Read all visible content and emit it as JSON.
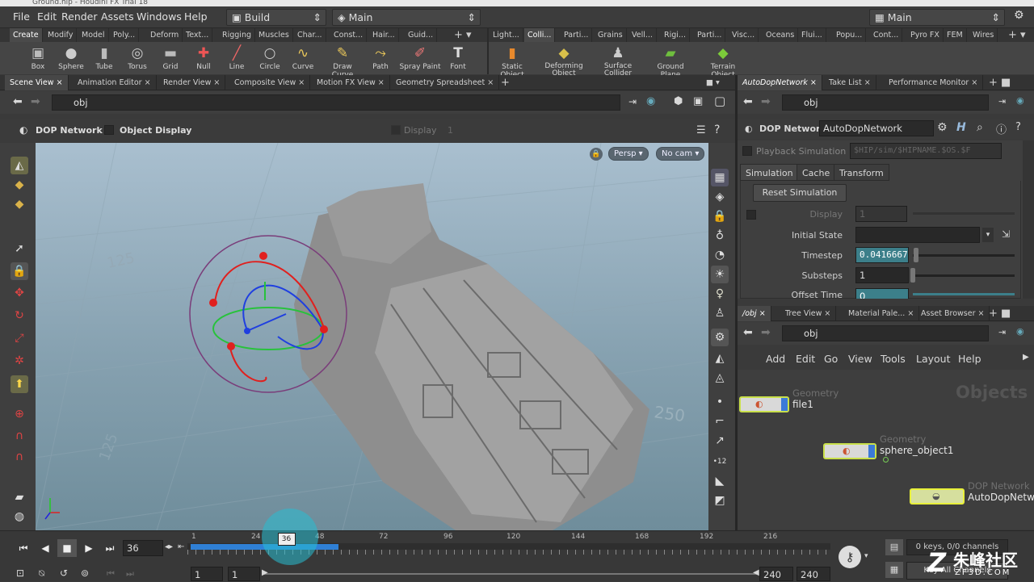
{
  "window": {
    "title": "Ground.hip - Houdini FX Trial 18"
  },
  "menu": {
    "items": [
      "File",
      "Edit",
      "Render",
      "Assets",
      "Windows",
      "Help"
    ],
    "desktop_left": "Build",
    "desktop_center": "Main",
    "desktop_right": "Main"
  },
  "shelf_tabs_left": [
    "Create",
    "Modify",
    "Model",
    "Poly...",
    "Deform",
    "Text...",
    "Rigging",
    "Muscles",
    "Char...",
    "Const...",
    "Hair...",
    "Guid..."
  ],
  "shelf_tabs_right": [
    "Light...",
    "Colli...",
    "Parti...",
    "Grains",
    "Vell...",
    "Rigi...",
    "Parti...",
    "Visc...",
    "Oceans",
    "Flui...",
    "Popu...",
    "Cont...",
    "Pyro FX",
    "FEM",
    "Wires"
  ],
  "tools_left": [
    {
      "label": "Box",
      "icon": "box-icon"
    },
    {
      "label": "Sphere",
      "icon": "sphere-icon"
    },
    {
      "label": "Tube",
      "icon": "tube-icon"
    },
    {
      "label": "Torus",
      "icon": "torus-icon"
    },
    {
      "label": "Grid",
      "icon": "grid-icon"
    },
    {
      "label": "Null",
      "icon": "null-icon"
    },
    {
      "label": "Line",
      "icon": "line-icon"
    },
    {
      "label": "Circle",
      "icon": "circle-icon"
    },
    {
      "label": "Curve",
      "icon": "curve-icon"
    },
    {
      "label": "Draw Curve",
      "icon": "draw-curve-icon"
    },
    {
      "label": "Path",
      "icon": "path-icon"
    },
    {
      "label": "Spray Paint",
      "icon": "spray-paint-icon"
    },
    {
      "label": "Font",
      "icon": "font-icon"
    }
  ],
  "tools_right": [
    {
      "label": "Static Object",
      "icon": "static-object-icon"
    },
    {
      "label": "Deforming Object",
      "icon": "deforming-object-icon"
    },
    {
      "label": "Surface Collider",
      "icon": "surface-collider-icon"
    },
    {
      "label": "Ground Plane",
      "icon": "ground-plane-icon"
    },
    {
      "label": "Terrain Object",
      "icon": "terrain-object-icon"
    }
  ],
  "viewer_tabs": [
    "Scene View",
    "Animation Editor",
    "Render View",
    "Composite View",
    "Motion FX View",
    "Geometry Spreadsheet"
  ],
  "viewer": {
    "path": "obj",
    "network_type": "DOP Network",
    "object_display": "Object Display",
    "display": "Display",
    "display_value": "1",
    "camera_persp": "Persp",
    "camera": "No cam",
    "grid_labels": [
      "125",
      "250",
      "125"
    ]
  },
  "params_tabs": [
    "AutoDopNetwork",
    "Take List",
    "Performance Monitor"
  ],
  "params": {
    "path": "obj",
    "type": "DOP Network",
    "name": "AutoDopNetwork",
    "playback": "Playback Simulation",
    "playback_path": "$HIP/sim/$HIPNAME.$OS.$F",
    "subtabs": [
      "Simulation",
      "Cache",
      "Transform"
    ],
    "reset_button": "Reset Simulation",
    "display_label": "Display",
    "display_value": "1",
    "initial_state_label": "Initial State",
    "timestep_label": "Timestep",
    "timestep_value": "0.0416667",
    "substeps_label": "Substeps",
    "substeps_value": "1",
    "offset_label": "Offset Time",
    "offset_value": "0"
  },
  "network_tabs": [
    "/obj",
    "Tree View",
    "Material Pale...",
    "Asset Browser"
  ],
  "network": {
    "path": "obj",
    "menu": [
      "Add",
      "Edit",
      "Go",
      "View",
      "Tools",
      "Layout",
      "Help"
    ],
    "watermark": "Objects",
    "nodes": [
      {
        "type": "Geometry",
        "name": "file1"
      },
      {
        "type": "Geometry",
        "name": "sphere_object1"
      },
      {
        "type": "DOP Network",
        "name": "AutoDopNetwork"
      }
    ]
  },
  "timeline": {
    "frame": "36",
    "ticks": [
      "1",
      "24",
      "48",
      "72",
      "96",
      "120",
      "144",
      "168",
      "192",
      "216"
    ],
    "marker": "36",
    "start": "1",
    "start2": "1",
    "end": "240",
    "end2": "240",
    "keys": "0 keys, 0/0 channels",
    "key_all": "Key All Channels",
    "playhead_fraction": 0.15
  },
  "logo": {
    "text": "朱峰社区",
    "sub": "ZF3D.COM"
  }
}
